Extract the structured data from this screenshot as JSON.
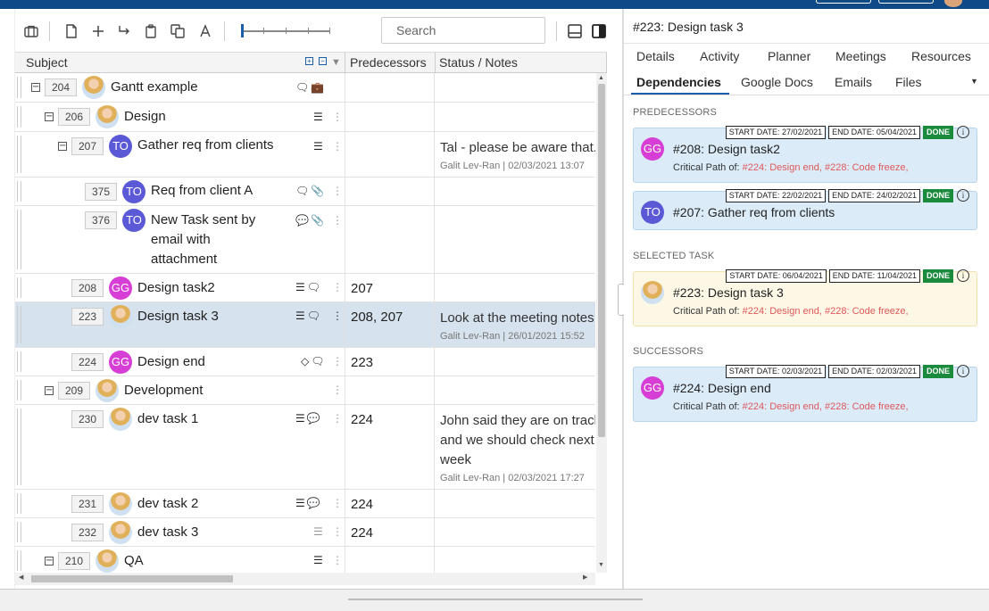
{
  "toolbar": {
    "tools": [
      "briefcase-icon",
      "new-file-icon",
      "plus-icon",
      "indent-arrow-icon",
      "clipboard-icon",
      "copy-icon",
      "text-icon"
    ],
    "search_placeholder": "Search",
    "zoom_level": 0.0
  },
  "grid": {
    "columns": [
      "Subject",
      "Predecessors",
      "Status / Notes"
    ],
    "rows": [
      {
        "id": "204",
        "name": "Gantt example",
        "avatar": "photo",
        "level": 0,
        "toggle": "⊟",
        "predecessors": "",
        "notes": "",
        "notes_meta": "",
        "icons": "comments, briefcase"
      },
      {
        "id": "206",
        "name": "Design",
        "avatar": "photo",
        "level": 1,
        "toggle": "⊟",
        "predecessors": "",
        "notes": "",
        "notes_meta": "",
        "icons": "gantt"
      },
      {
        "id": "207",
        "name": "Gather req from clients",
        "avatar": "TO",
        "level": 2,
        "toggle": "⊟",
        "predecessors": "",
        "notes": "Tal - please be aware that...",
        "notes_meta": "Galit Lev-Ran | 02/03/2021 13:07",
        "icons": "gantt"
      },
      {
        "id": "375",
        "name": "Req from client A",
        "avatar": "TO",
        "level": 3,
        "toggle": "",
        "predecessors": "",
        "notes": "",
        "notes_meta": "",
        "icons": "comments, attachment"
      },
      {
        "id": "376",
        "name_lines": [
          "New Task sent by",
          "email with",
          "attachment"
        ],
        "avatar": "TO",
        "level": 3,
        "toggle": "",
        "predecessors": "",
        "notes": "",
        "notes_meta": "",
        "icons": "comments-blue, attachment"
      },
      {
        "id": "208",
        "name": "Design task2",
        "avatar": "GG",
        "level": 2,
        "toggle": "",
        "predecessors": "207",
        "notes": "",
        "notes_meta": "",
        "icons": "gantt, comments"
      },
      {
        "id": "223",
        "name": "Design task 3",
        "avatar": "photo",
        "level": 2,
        "toggle": "",
        "predecessors": "208, 207",
        "notes": "Look at the meeting notes",
        "notes_meta": "Galit Lev-Ran | 26/01/2021 15:52",
        "icons": "gantt, comments",
        "selected": true
      },
      {
        "id": "224",
        "name": "Design end",
        "avatar": "GG",
        "level": 2,
        "toggle": "",
        "predecessors": "223",
        "notes": "",
        "notes_meta": "",
        "icons": "milestone, comments"
      },
      {
        "id": "209",
        "name": "Development",
        "avatar": "photo",
        "level": 1,
        "toggle": "⊟",
        "predecessors": "",
        "notes": "",
        "notes_meta": "",
        "icons": ""
      },
      {
        "id": "230",
        "name": "dev task 1",
        "avatar": "photo",
        "level": 2,
        "toggle": "",
        "predecessors": "224",
        "notes_lines": [
          "John said they are on track",
          "and we should check next",
          "week"
        ],
        "notes_meta": "Galit Lev-Ran | 02/03/2021 17:27",
        "icons": "gantt, comments-blue"
      },
      {
        "id": "231",
        "name": "dev task 2",
        "avatar": "photo",
        "level": 2,
        "toggle": "",
        "predecessors": "224",
        "notes": "",
        "notes_meta": "",
        "icons": "gantt, comments-blue"
      },
      {
        "id": "232",
        "name": "dev task 3",
        "avatar": "photo",
        "level": 2,
        "toggle": "",
        "predecessors": "224",
        "notes": "",
        "notes_meta": "",
        "icons": "gantt-gray"
      },
      {
        "id": "210",
        "name": "QA",
        "avatar": "photo",
        "level": 1,
        "toggle": "⊟",
        "predecessors": "",
        "notes": "",
        "notes_meta": "",
        "icons": "gantt"
      }
    ]
  },
  "panel": {
    "title": "#223: Design task 3",
    "tabs_row1": [
      "Details",
      "Activity",
      "Planner",
      "Meetings",
      "Resources"
    ],
    "tabs_row2": [
      "Dependencies",
      "Google Docs",
      "Emails",
      "Files"
    ],
    "active_tab": "Dependencies",
    "sections": {
      "predecessors": "PREDECESSORS",
      "selected": "SELECTED TASK",
      "successors": "SUCCESSORS"
    },
    "critical_label": "Critical Path of:",
    "cards": [
      {
        "title": "#208: Design task2",
        "avatar": "GG",
        "start": "START DATE: 27/02/2021",
        "end": "END DATE: 05/04/2021",
        "status": "DONE",
        "critical": "#224: Design end, #228: Code freeze,"
      },
      {
        "title": "#207: Gather req from clients",
        "avatar": "TO",
        "start": "START DATE: 22/02/2021",
        "end": "END DATE: 24/02/2021",
        "status": "DONE",
        "critical": ""
      },
      {
        "title": "#223: Design task 3",
        "avatar": "photo",
        "start": "START DATE: 06/04/2021",
        "end": "END DATE: 11/04/2021",
        "status": "DONE",
        "critical": "#224: Design end, #228: Code freeze,"
      },
      {
        "title": "#224: Design end",
        "avatar": "GG",
        "start": "START DATE: 02/03/2021",
        "end": "END DATE: 02/03/2021",
        "status": "DONE",
        "critical": "#224: Design end, #228: Code freeze,"
      }
    ]
  },
  "colors": {
    "accent": "#1a5ea8",
    "topbar": "#0f4a87",
    "done": "#1a8a3c",
    "critical_link": "#e0575b",
    "selected_row": "#d6e2ed",
    "card_blue": "#dbecf8",
    "card_yellow": "#fdf8e6"
  }
}
